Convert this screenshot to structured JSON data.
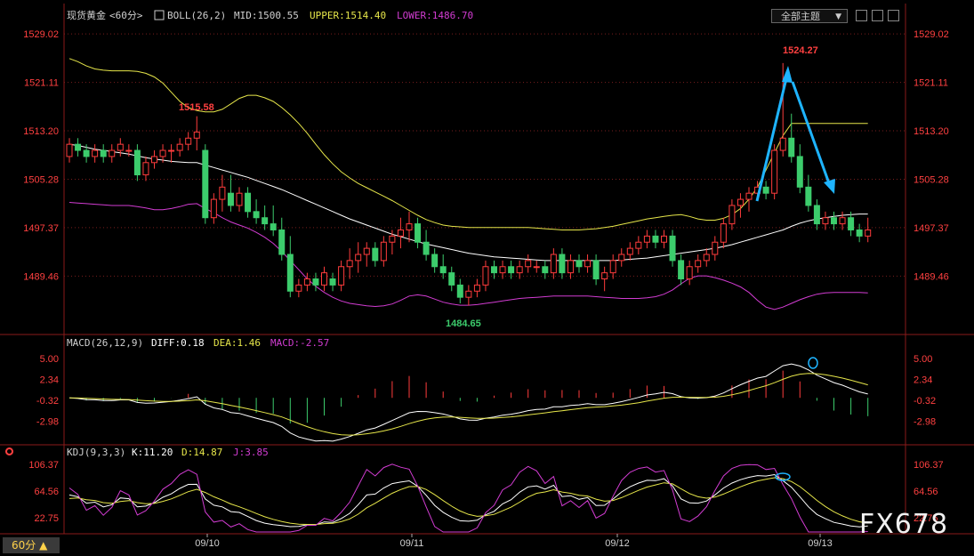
{
  "header": {
    "symbol": "现货黄金",
    "period_tag": "<60分>",
    "boll_label": "BOLL(26,2)",
    "mid": "MID:1500.55",
    "upper": "UPPER:1514.40",
    "lower": "LOWER:1486.70",
    "theme_button": "全部主题",
    "period_button": "60分 ▲"
  },
  "watermark": "FX678",
  "colors": {
    "up": "#ff3c3c",
    "down": "#3ccc6c",
    "mid": "#ffffff",
    "upper": "#e6e64a",
    "lower": "#d23cd2",
    "arrow": "#1eb4ff",
    "grid": "#7a1e1e",
    "axis_text": "#ff4040"
  },
  "price_axis": {
    "ticks": [
      "1529.02",
      "1521.11",
      "1513.20",
      "1505.28",
      "1497.37",
      "1489.46"
    ],
    "ylim": [
      1480.5,
      1530.5
    ]
  },
  "x_labels": [
    "09/10",
    "09/11",
    "09/12",
    "09/13"
  ],
  "annotations": {
    "high1": "1515.58",
    "low": "1484.65",
    "high2": "1524.27"
  },
  "macd": {
    "label": "MACD(26,12,9)",
    "diff": "DIFF:0.18",
    "dea": "DEA:1.46",
    "macd": "MACD:-2.57",
    "ticks": [
      "5.00",
      "2.34",
      "-0.32",
      "-2.98"
    ]
  },
  "kdj": {
    "label": "KDJ(9,3,3)",
    "k": "K:11.20",
    "d": "D:14.87",
    "j": "J:3.85",
    "ticks": [
      "106.37",
      "64.56",
      "22.75"
    ]
  },
  "chart_data": {
    "type": "candlestick",
    "candles": [
      [
        1509,
        1512,
        1508,
        1511
      ],
      [
        1511,
        1512,
        1509,
        1510
      ],
      [
        1510,
        1511,
        1508,
        1509
      ],
      [
        1509,
        1511,
        1508,
        1510
      ],
      [
        1510,
        1511,
        1508,
        1509
      ],
      [
        1509,
        1511,
        1508,
        1510
      ],
      [
        1510,
        1512,
        1509,
        1511
      ],
      [
        1510,
        1511,
        1509,
        1510
      ],
      [
        1510,
        1511,
        1505,
        1506
      ],
      [
        1506,
        1509,
        1505,
        1508
      ],
      [
        1508,
        1510,
        1507,
        1509
      ],
      [
        1509,
        1511,
        1508,
        1510
      ],
      [
        1510,
        1511,
        1508,
        1510
      ],
      [
        1510,
        1512,
        1509,
        1511
      ],
      [
        1511,
        1513,
        1510,
        1512
      ],
      [
        1512,
        1515.58,
        1510,
        1513
      ],
      [
        1510,
        1511,
        1498,
        1499
      ],
      [
        1499,
        1503,
        1498,
        1502
      ],
      [
        1502,
        1506,
        1500,
        1504
      ],
      [
        1503,
        1506,
        1500,
        1501
      ],
      [
        1501,
        1504,
        1500,
        1503
      ],
      [
        1503,
        1504,
        1499,
        1500
      ],
      [
        1500,
        1502,
        1498,
        1499
      ],
      [
        1499,
        1501,
        1497,
        1498
      ],
      [
        1498,
        1501,
        1496,
        1497
      ],
      [
        1497,
        1499,
        1492,
        1493
      ],
      [
        1493,
        1496,
        1486,
        1487
      ],
      [
        1487,
        1489,
        1486,
        1488
      ],
      [
        1488,
        1490,
        1487,
        1489
      ],
      [
        1489,
        1490,
        1487,
        1488
      ],
      [
        1488,
        1491,
        1487,
        1490
      ],
      [
        1489,
        1490,
        1487,
        1488
      ],
      [
        1488,
        1492,
        1487,
        1491
      ],
      [
        1491,
        1494,
        1489,
        1492
      ],
      [
        1492,
        1495,
        1490,
        1493
      ],
      [
        1493,
        1495,
        1491,
        1494
      ],
      [
        1494,
        1495,
        1491,
        1492
      ],
      [
        1492,
        1496,
        1491,
        1495
      ],
      [
        1495,
        1497,
        1493,
        1496
      ],
      [
        1496,
        1499,
        1494,
        1497
      ],
      [
        1497,
        1500,
        1495,
        1498
      ],
      [
        1498,
        1499,
        1494,
        1495
      ],
      [
        1495,
        1497,
        1492,
        1493
      ],
      [
        1493,
        1494,
        1490,
        1491
      ],
      [
        1491,
        1493,
        1489,
        1490
      ],
      [
        1490,
        1491,
        1487,
        1488
      ],
      [
        1488,
        1489,
        1485,
        1486
      ],
      [
        1486,
        1488,
        1484.65,
        1487
      ],
      [
        1487,
        1489,
        1486,
        1488
      ],
      [
        1488,
        1492,
        1487,
        1491
      ],
      [
        1491,
        1492,
        1489,
        1490
      ],
      [
        1490,
        1492,
        1489,
        1491
      ],
      [
        1491,
        1492,
        1489,
        1490
      ],
      [
        1490,
        1492,
        1489,
        1491
      ],
      [
        1491,
        1493,
        1490,
        1492
      ],
      [
        1491,
        1492,
        1490,
        1491
      ],
      [
        1491,
        1492,
        1489,
        1490
      ],
      [
        1490,
        1494,
        1489,
        1493
      ],
      [
        1493,
        1494,
        1489,
        1490
      ],
      [
        1490,
        1493,
        1489,
        1492
      ],
      [
        1492,
        1493,
        1490,
        1491
      ],
      [
        1491,
        1493,
        1490,
        1492
      ],
      [
        1492,
        1493,
        1488,
        1489
      ],
      [
        1489,
        1491,
        1487,
        1490
      ],
      [
        1490,
        1493,
        1489,
        1492
      ],
      [
        1492,
        1494,
        1491,
        1493
      ],
      [
        1493,
        1495,
        1492,
        1494
      ],
      [
        1494,
        1496,
        1493,
        1495
      ],
      [
        1495,
        1497,
        1494,
        1496
      ],
      [
        1496,
        1497,
        1494,
        1495
      ],
      [
        1495,
        1497,
        1494,
        1496
      ],
      [
        1496,
        1497,
        1491,
        1492
      ],
      [
        1492,
        1493,
        1488,
        1489
      ],
      [
        1489,
        1492,
        1488,
        1491
      ],
      [
        1491,
        1493,
        1490,
        1492
      ],
      [
        1492,
        1494,
        1491,
        1493
      ],
      [
        1493,
        1496,
        1492,
        1495
      ],
      [
        1495,
        1499,
        1494,
        1498
      ],
      [
        1498,
        1502,
        1497,
        1501
      ],
      [
        1501,
        1503,
        1499,
        1502
      ],
      [
        1502,
        1504,
        1500,
        1503
      ],
      [
        1503,
        1505,
        1502,
        1504
      ],
      [
        1504,
        1505,
        1502,
        1503
      ],
      [
        1503,
        1511,
        1502,
        1510
      ],
      [
        1510,
        1524.27,
        1509,
        1512
      ],
      [
        1512,
        1516,
        1508,
        1509
      ],
      [
        1509,
        1511,
        1503,
        1504
      ],
      [
        1504,
        1506,
        1500,
        1501
      ],
      [
        1501,
        1502,
        1497,
        1498
      ],
      [
        1498,
        1500,
        1497,
        1499
      ],
      [
        1499,
        1500,
        1497,
        1498
      ],
      [
        1498,
        1500,
        1497,
        1499
      ],
      [
        1499,
        1500,
        1496,
        1497
      ],
      [
        1497,
        1498,
        1495,
        1496
      ],
      [
        1496,
        1499,
        1495,
        1497
      ]
    ],
    "series": [
      {
        "name": "MID",
        "values": [
          1511,
          1510.8,
          1510.5,
          1510.2,
          1510,
          1509.8,
          1509.6,
          1509.4,
          1509.1,
          1508.8,
          1508.6,
          1508.4,
          1508.2,
          1508.1,
          1508,
          1508,
          1507.6,
          1507.2,
          1506.8,
          1506.4,
          1506,
          1505.6,
          1505.1,
          1504.6,
          1504.1,
          1503.6,
          1503,
          1502.4,
          1501.8,
          1501.2,
          1500.6,
          1500,
          1499.4,
          1498.8,
          1498.3,
          1497.8,
          1497.3,
          1496.8,
          1496.3,
          1495.9,
          1495.5,
          1495.1,
          1494.7,
          1494.4,
          1494.1,
          1493.8,
          1493.5,
          1493.2,
          1493,
          1492.8,
          1492.6,
          1492.5,
          1492.4,
          1492.3,
          1492.2,
          1492.1,
          1492,
          1492,
          1492,
          1492,
          1492,
          1492,
          1492,
          1492,
          1492,
          1492.1,
          1492.2,
          1492.3,
          1492.4,
          1492.6,
          1492.8,
          1493,
          1493.2,
          1493.4,
          1493.6,
          1493.8,
          1494,
          1494.3,
          1494.6,
          1495,
          1495.4,
          1495.8,
          1496.2,
          1496.6,
          1497,
          1497.6,
          1498.1,
          1498.5,
          1498.8,
          1499,
          1499.2,
          1499.4,
          1499.5,
          1499.6,
          1499.6
        ]
      },
      {
        "name": "UPPER",
        "values": [
          1525,
          1524.5,
          1523.8,
          1523.3,
          1523.1,
          1523,
          1523,
          1523,
          1522.9,
          1522.6,
          1522,
          1521,
          1519.5,
          1518,
          1517,
          1516.5,
          1516.3,
          1516.3,
          1516.7,
          1517.6,
          1518.5,
          1519,
          1519,
          1518.6,
          1518,
          1517,
          1515.8,
          1514.4,
          1512.8,
          1511,
          1509.3,
          1507.8,
          1506.5,
          1505.5,
          1504.6,
          1503.9,
          1503.2,
          1502.5,
          1501.8,
          1501,
          1500.2,
          1499.4,
          1498.7,
          1498.2,
          1497.8,
          1497.6,
          1497.5,
          1497.4,
          1497.4,
          1497.4,
          1497.4,
          1497.4,
          1497.4,
          1497.4,
          1497.4,
          1497.3,
          1497.2,
          1497.1,
          1497,
          1497,
          1497,
          1497.1,
          1497.2,
          1497.4,
          1497.6,
          1497.9,
          1498.2,
          1498.5,
          1498.8,
          1499,
          1499.2,
          1499.4,
          1499.5,
          1499.2,
          1498.8,
          1498.6,
          1498.6,
          1498.9,
          1499.5,
          1500.5,
          1502,
          1504,
          1506.8,
          1509.6,
          1512.4,
          1514.4,
          1514.4,
          1514.4,
          1514.4,
          1514.4,
          1514.4,
          1514.4,
          1514.4,
          1514.4,
          1514.4
        ]
      },
      {
        "name": "LOWER",
        "values": [
          1501.5,
          1501.4,
          1501.3,
          1501.2,
          1501.1,
          1501,
          1501,
          1501,
          1500.8,
          1500.6,
          1500.3,
          1500.3,
          1500.5,
          1500.8,
          1501.2,
          1501.3,
          1500.5,
          1499.8,
          1499,
          1498.3,
          1497.8,
          1497.3,
          1496.6,
          1495.8,
          1494.8,
          1493.5,
          1492,
          1490.5,
          1489,
          1487.8,
          1486.8,
          1486,
          1485.4,
          1485,
          1484.8,
          1484.6,
          1484.5,
          1484.6,
          1484.9,
          1485.5,
          1486.2,
          1486.4,
          1486.2,
          1485.7,
          1485.2,
          1484.9,
          1484.7,
          1484.7,
          1484.8,
          1485,
          1485.2,
          1485.4,
          1485.6,
          1485.8,
          1485.9,
          1486,
          1486.1,
          1486.2,
          1486.2,
          1486.2,
          1486.2,
          1486.2,
          1486.1,
          1486,
          1485.9,
          1485.8,
          1485.8,
          1485.8,
          1485.9,
          1486.1,
          1486.5,
          1487.2,
          1488.2,
          1489.1,
          1489.5,
          1489.5,
          1489.2,
          1488.8,
          1488.3,
          1487.7,
          1486.8,
          1485.5,
          1484.4,
          1484,
          1484.4,
          1485,
          1485.6,
          1486.1,
          1486.5,
          1486.7,
          1486.8,
          1486.8,
          1486.8,
          1486.8,
          1486.7
        ]
      }
    ],
    "ylim": [
      1480.5,
      1530.5
    ]
  }
}
